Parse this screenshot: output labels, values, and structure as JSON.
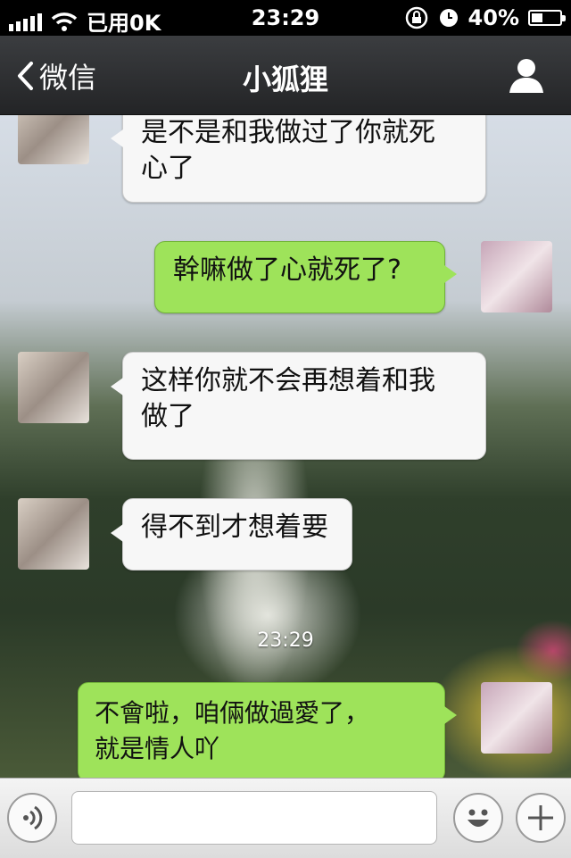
{
  "status_bar": {
    "carrier": "已用0K",
    "time": "23:29",
    "battery_percent": "40%",
    "battery_level": 0.4,
    "signal_bars": 5
  },
  "nav": {
    "back_label": "微信",
    "title": "小狐狸"
  },
  "messages": [
    {
      "side": "in",
      "text": "是不是和我做过了你就死\n心了"
    },
    {
      "side": "out",
      "text": "幹嘛做了心就死了?"
    },
    {
      "side": "in",
      "text": "这样你就不会再想着和我\n做了"
    },
    {
      "side": "in",
      "text": "得不到才想着要"
    },
    {
      "side": "out",
      "text": "不會啦，咱倆做過愛了，\n就是情人吖"
    }
  ],
  "timestamp": "23:29",
  "input": {
    "value": "",
    "placeholder": ""
  },
  "icons": {
    "back": "chevron-left-icon",
    "profile": "person-icon",
    "wifi": "wifi-icon",
    "lock_rotation": "rotation-lock-icon",
    "alarm": "alarm-icon",
    "battery": "battery-icon",
    "voice": "voice-icon",
    "emoji": "emoji-icon",
    "more": "plus-icon"
  },
  "colors": {
    "bubble_in": "#f7f7f7",
    "bubble_out": "#9ee35a",
    "nav_bg": "#2e2f31"
  }
}
